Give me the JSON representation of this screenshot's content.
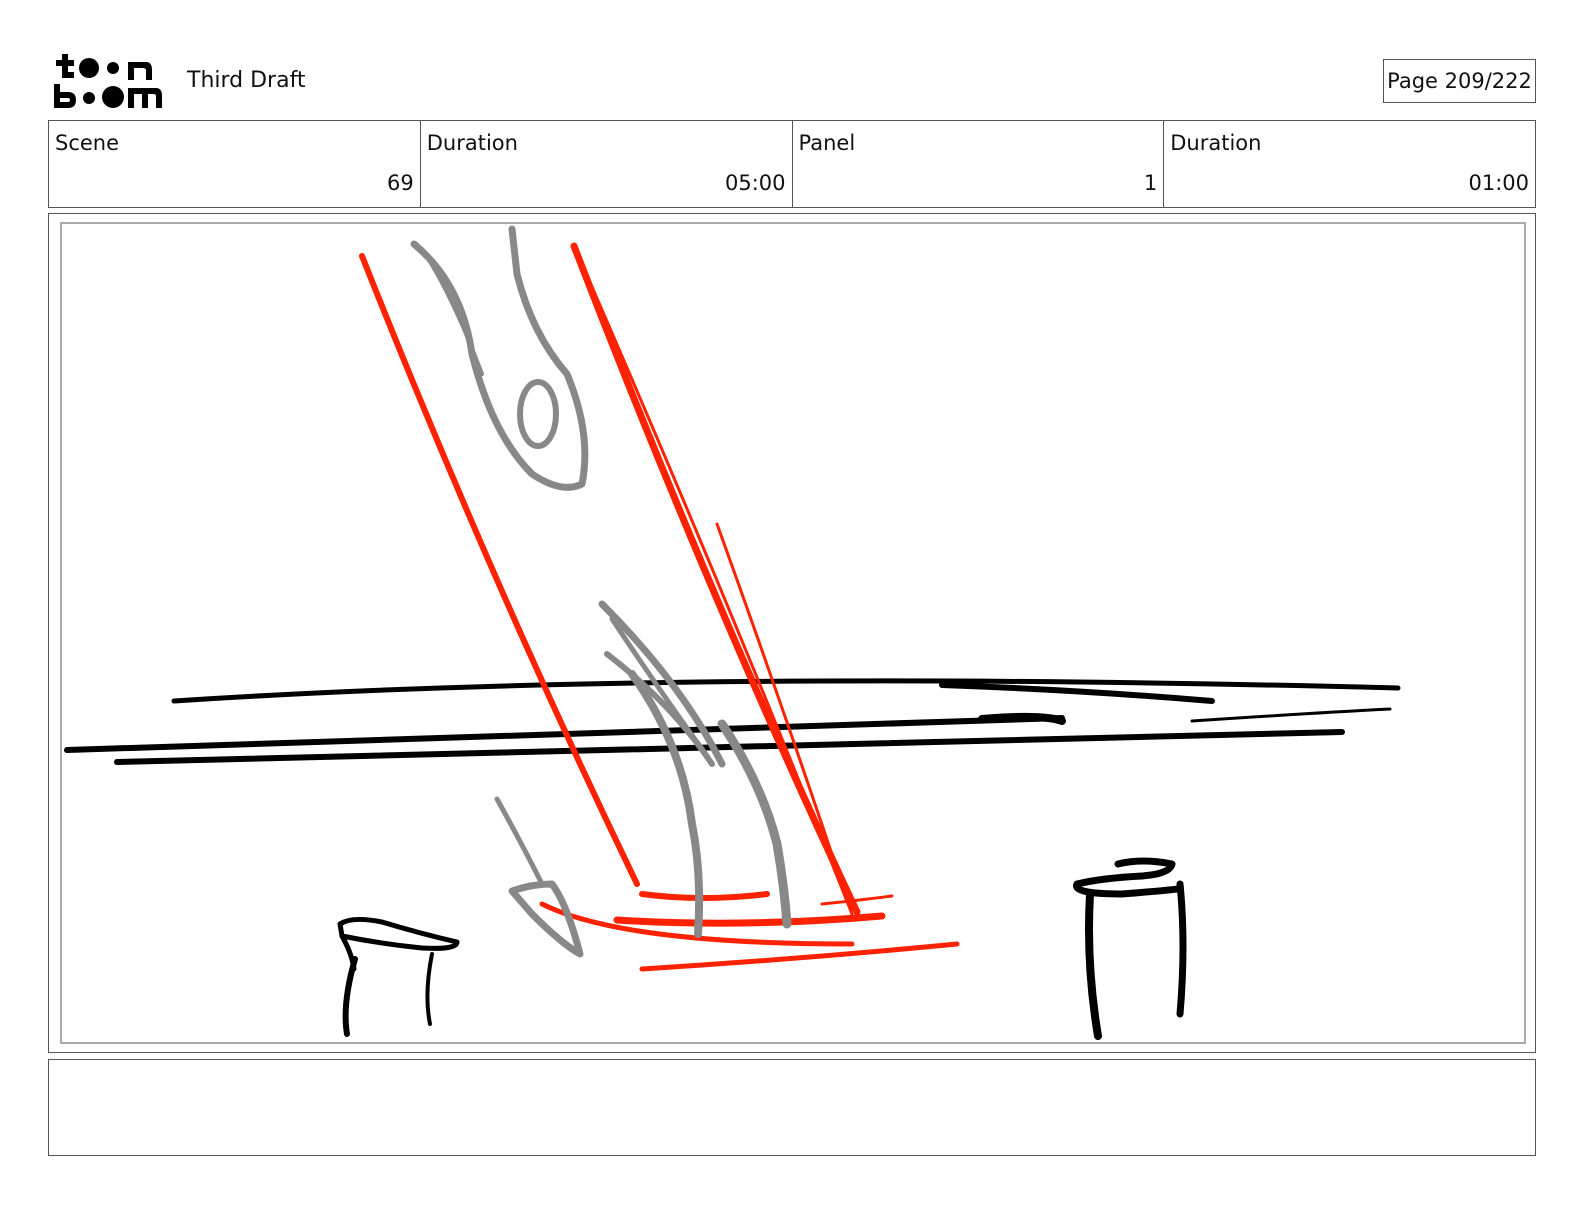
{
  "header": {
    "logo_line1": "toon",
    "logo_line2": "boom",
    "title": "Third Draft",
    "page": "Page 209/222"
  },
  "info": {
    "scene_label": "Scene",
    "scene_value": "69",
    "scene_duration_label": "Duration",
    "scene_duration_value": "05:00",
    "panel_label": "Panel",
    "panel_value": "1",
    "panel_duration_label": "Duration",
    "panel_duration_value": "01:00"
  },
  "notes": {
    "text": ""
  },
  "colors": {
    "ink": "#000000",
    "sketch_red": "#ff2200",
    "sketch_gray": "#888888",
    "border": "#555555",
    "panel_frame": "#aaaaaa"
  }
}
